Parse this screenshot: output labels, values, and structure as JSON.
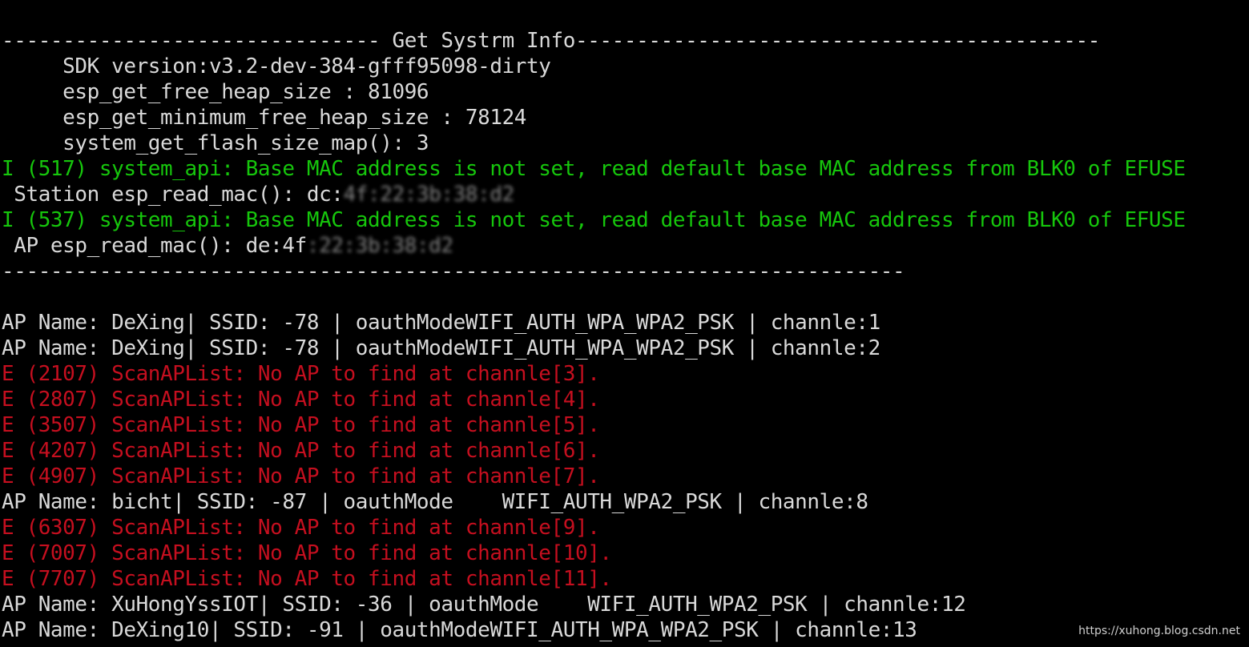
{
  "terminal": {
    "lines": [
      {
        "color": "white",
        "segments": [
          {
            "text": "------------------------------- Get Systrm Info-------------------------------------------"
          }
        ]
      },
      {
        "color": "white",
        "segments": [
          {
            "text": "     SDK version:v3.2-dev-384-gfff95098-dirty"
          }
        ]
      },
      {
        "color": "white",
        "segments": [
          {
            "text": "     esp_get_free_heap_size : 81096"
          }
        ]
      },
      {
        "color": "white",
        "segments": [
          {
            "text": "     esp_get_minimum_free_heap_size : 78124"
          }
        ]
      },
      {
        "color": "white",
        "segments": [
          {
            "text": "     system_get_flash_size_map(): 3"
          }
        ]
      },
      {
        "color": "green",
        "segments": [
          {
            "text": "I (517) system_api: Base MAC address is not set, read default base MAC address from BLK0 of EFUSE"
          }
        ]
      },
      {
        "color": "white",
        "segments": [
          {
            "text": " Station esp_read_mac(): dc:"
          },
          {
            "text": "4f:22:3b:38:d2",
            "blurred": true
          }
        ]
      },
      {
        "color": "green",
        "segments": [
          {
            "text": "I (537) system_api: Base MAC address is not set, read default base MAC address from BLK0 of EFUSE"
          }
        ]
      },
      {
        "color": "white",
        "segments": [
          {
            "text": " AP esp_read_mac(): de:4f"
          },
          {
            "text": ":22:3b:38:d2",
            "blurred": true
          }
        ]
      },
      {
        "color": "white",
        "segments": [
          {
            "text": "--------------------------------------------------------------------------"
          }
        ]
      },
      {
        "color": "blank",
        "segments": []
      },
      {
        "color": "white",
        "segments": [
          {
            "text": "AP Name: DeXing| SSID: -78 | oauthModeWIFI_AUTH_WPA_WPA2_PSK | channle:1"
          }
        ]
      },
      {
        "color": "white",
        "segments": [
          {
            "text": "AP Name: DeXing| SSID: -78 | oauthModeWIFI_AUTH_WPA_WPA2_PSK | channle:2"
          }
        ]
      },
      {
        "color": "red",
        "segments": [
          {
            "text": "E (2107) ScanAPList: No AP to find at channle[3]."
          }
        ]
      },
      {
        "color": "red",
        "segments": [
          {
            "text": "E (2807) ScanAPList: No AP to find at channle[4]."
          }
        ]
      },
      {
        "color": "red",
        "segments": [
          {
            "text": "E (3507) ScanAPList: No AP to find at channle[5]."
          }
        ]
      },
      {
        "color": "red",
        "segments": [
          {
            "text": "E (4207) ScanAPList: No AP to find at channle[6]."
          }
        ]
      },
      {
        "color": "red",
        "segments": [
          {
            "text": "E (4907) ScanAPList: No AP to find at channle[7]."
          }
        ]
      },
      {
        "color": "white",
        "segments": [
          {
            "text": "AP Name: bicht| SSID: -87 | oauthMode    WIFI_AUTH_WPA2_PSK | channle:8"
          }
        ]
      },
      {
        "color": "red",
        "segments": [
          {
            "text": "E (6307) ScanAPList: No AP to find at channle[9]."
          }
        ]
      },
      {
        "color": "red",
        "segments": [
          {
            "text": "E (7007) ScanAPList: No AP to find at channle[10]."
          }
        ]
      },
      {
        "color": "red",
        "segments": [
          {
            "text": "E (7707) ScanAPList: No AP to find at channle[11]."
          }
        ]
      },
      {
        "color": "white",
        "segments": [
          {
            "text": "AP Name: XuHongYssIOT| SSID: -36 | oauthMode    WIFI_AUTH_WPA2_PSK | channle:12"
          }
        ]
      },
      {
        "color": "white",
        "segments": [
          {
            "text": "AP Name: DeXing10| SSID: -91 | oauthModeWIFI_AUTH_WPA_WPA2_PSK | channle:13"
          }
        ]
      }
    ]
  },
  "watermark": "https://xuhong.blog.csdn.net",
  "colors": {
    "background": "#000000",
    "white": "#d9d9d9",
    "green": "#16c60c",
    "red": "#c50f1f"
  }
}
